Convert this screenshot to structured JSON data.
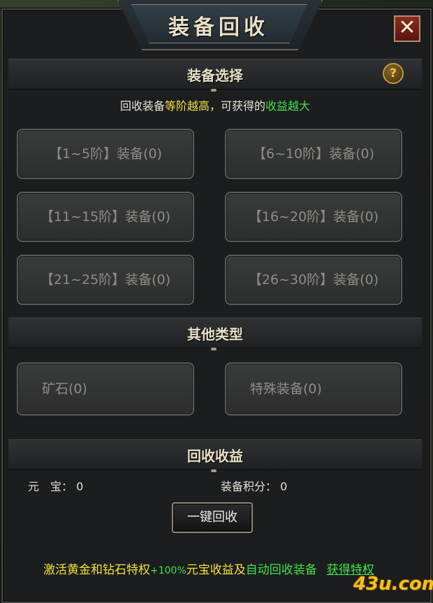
{
  "window": {
    "title": "装备回收",
    "close_label": "✕"
  },
  "equip_select": {
    "heading": "装备选择",
    "help_label": "?",
    "info": {
      "p1": "回收装备",
      "p2": "等阶越高",
      "p3": "，可获得的",
      "p4": "收益越大"
    },
    "tiers": [
      "【1~5阶】装备(0)",
      "【6~10阶】装备(0)",
      "【11~15阶】装备(0)",
      "【16~20阶】装备(0)",
      "【21~25阶】装备(0)",
      "【26~30阶】装备(0)"
    ]
  },
  "other_types": {
    "heading": "其他类型",
    "items": [
      "矿石(0)",
      "特殊装备(0)"
    ]
  },
  "income": {
    "heading": "回收收益",
    "yuanbao_label": "元　宝：",
    "yuanbao_value": "0",
    "points_label": "装备积分：",
    "points_value": "0",
    "recycle_button": "一键回收"
  },
  "promo": {
    "p1": "激活黄金和钻石特权",
    "p2": "+100%",
    "p3": "元宝收益及",
    "p4": "自动回收装备",
    "link": "获得特权"
  },
  "watermark": "43u.com",
  "colors": {
    "accent_yellow": "#f2e23a",
    "accent_green": "#43e04c",
    "close_red": "#8b2c1f"
  }
}
